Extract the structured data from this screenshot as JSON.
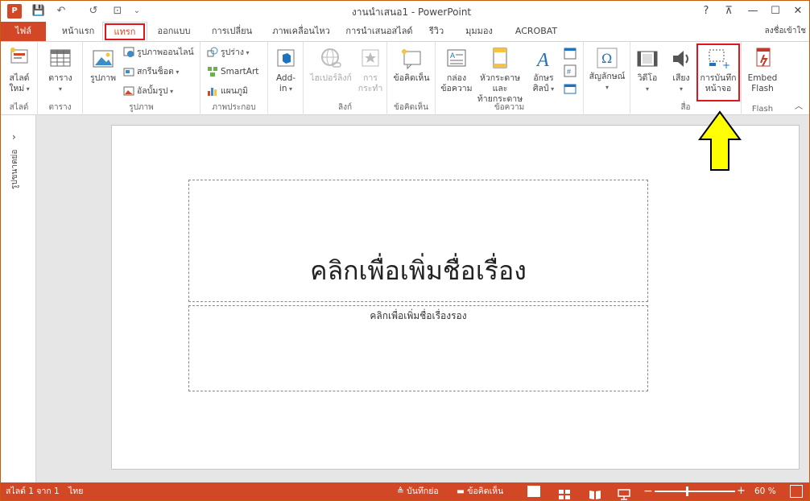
{
  "app": {
    "title": "งานนำเสนอ1 - PowerPoint",
    "icon_letter": "P"
  },
  "quick_access": {
    "save": "💾",
    "undo": "↶",
    "redo": "↺",
    "present": "⊡",
    "customize": "⌄"
  },
  "window_controls": {
    "help": "?",
    "ribbon_display": "⊼",
    "minimize": "—",
    "maximize": "☐",
    "close": "✕"
  },
  "tabs": [
    {
      "label": "ไฟล์"
    },
    {
      "label": "หน้าแรก"
    },
    {
      "label": "แทรก"
    },
    {
      "label": "ออกแบบ"
    },
    {
      "label": "การเปลี่ยน"
    },
    {
      "label": "ภาพเคลื่อนไหว"
    },
    {
      "label": "การนำเสนอสไลด์"
    },
    {
      "label": "รีวิว"
    },
    {
      "label": "มุมมอง"
    },
    {
      "label": "ACROBAT"
    }
  ],
  "signin": "ลงชื่อเข้าใช",
  "ribbon": {
    "slides": {
      "label": "สไลด์",
      "new_slide": "สไลด์",
      "new_slide_2": "ใหม่"
    },
    "tables": {
      "label": "ตาราง",
      "table": "ตาราง"
    },
    "images": {
      "label": "รูปภาพ",
      "pictures": "รูปภาพ",
      "online_pictures": "รูปภาพออนไลน์",
      "screenshot": "สกรีนช็อต",
      "photo_album": "อัลบั้มรูป"
    },
    "illustrations": {
      "label": "ภาพประกอบ",
      "shapes": "รูปร่าง",
      "smartart": "SmartArt",
      "chart": "แผนภูมิ"
    },
    "addins": {
      "label": "",
      "addin": "Add-",
      "addin_2": "in"
    },
    "links": {
      "label": "ลิงก์",
      "hyperlink": "ไฮเปอร์ลิงก์",
      "action": "การ",
      "action_2": "กระทำ"
    },
    "comments": {
      "label": "ข้อคิดเห็น",
      "comment": "ข้อคิดเห็น"
    },
    "text": {
      "label": "ข้อความ",
      "textbox": "กล่อง",
      "textbox_2": "ข้อความ",
      "header_footer": "หัวกระดาษและ",
      "header_footer_2": "ท้ายกระดาษ",
      "wordart": "อักษร",
      "wordart_2": "ศิลป์"
    },
    "symbols": {
      "label": "",
      "symbol": "สัญลักษณ์"
    },
    "media": {
      "label": "สื่อ",
      "video": "วิดีโอ",
      "audio": "เสียง",
      "screen_recording": "การบันทึก",
      "screen_recording_2": "หน้าจอ"
    },
    "flash": {
      "label": "Flash",
      "embed": "Embed",
      "embed_2": "Flash"
    }
  },
  "thumbnails": {
    "label": "รูปขนาดย่อ",
    "expand": "›"
  },
  "slide": {
    "title_placeholder": "คลิกเพื่อเพิ่มชื่อเรื่อง",
    "subtitle_placeholder": "คลิกเพื่อเพิ่มชื่อเรื่องรอง"
  },
  "status": {
    "slide_count": "สไลด์ 1 จาก 1",
    "language": "ไทย",
    "notes": "บันทึกย่อ",
    "comments": "ข้อคิดเห็น",
    "zoom_minus": "−",
    "zoom_plus": "+",
    "zoom": "60 %",
    "zoom_level": 0.4
  },
  "colors": {
    "accent": "#d24726",
    "highlight": "#e2141d",
    "arrow_fill": "#ffff00"
  }
}
